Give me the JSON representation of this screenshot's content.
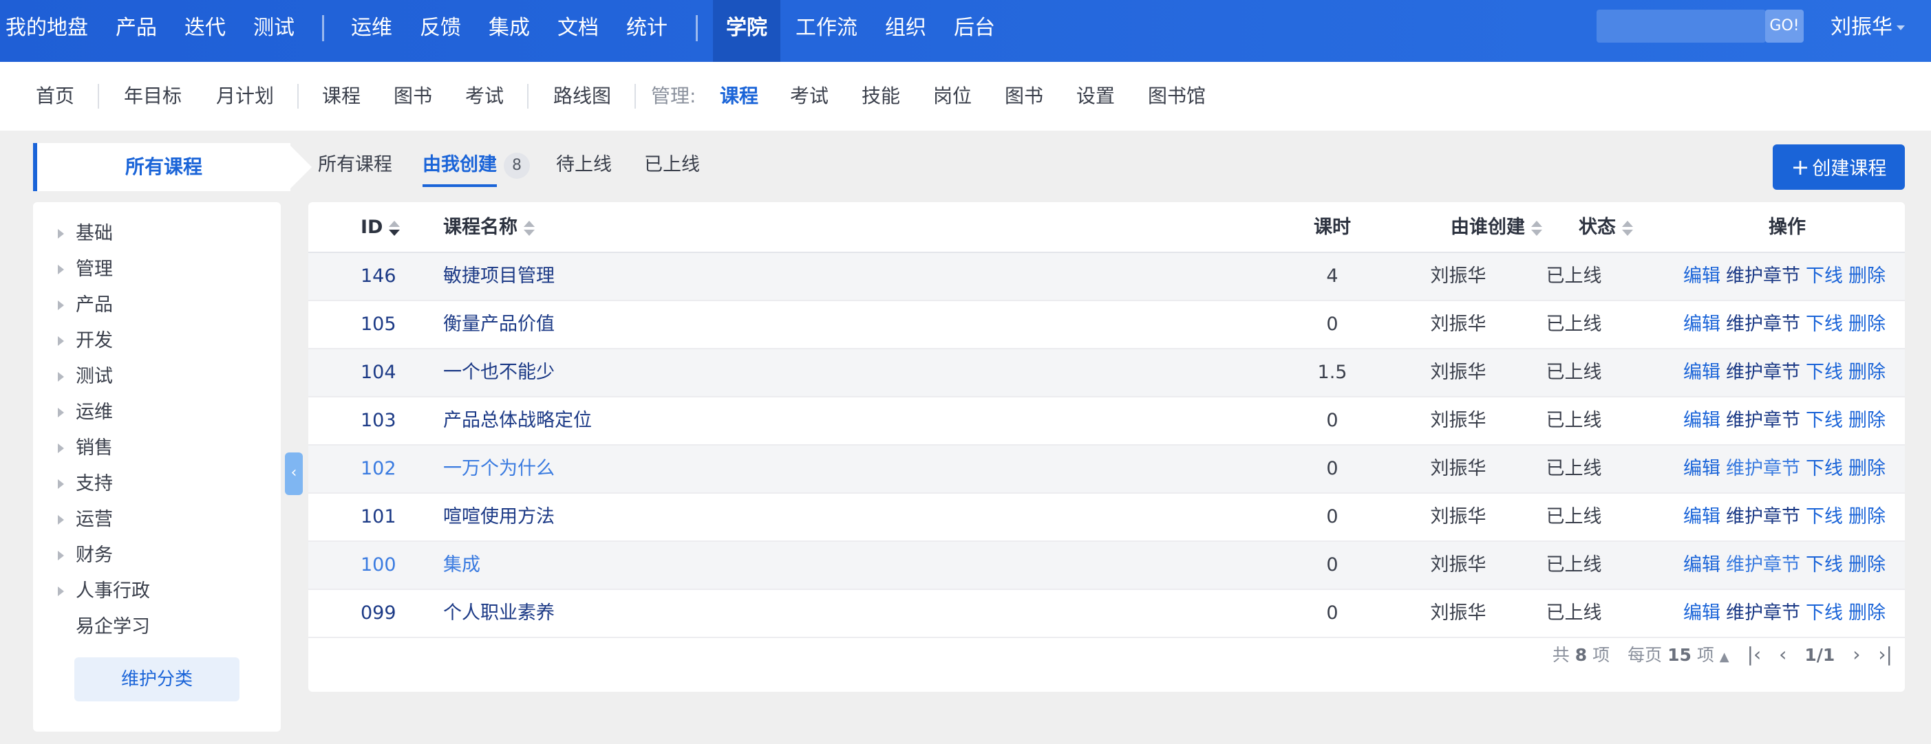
{
  "topnav": {
    "items": [
      "我的地盘",
      "产品",
      "迭代",
      "测试",
      "运维",
      "反馈",
      "集成",
      "文档",
      "统计",
      "学院",
      "工作流",
      "组织",
      "后台"
    ],
    "active": "学院",
    "search_placeholder": "",
    "search_button": "GO!",
    "user": "刘振华"
  },
  "subnav": {
    "items": [
      "首页",
      "年目标",
      "月计划",
      "课程",
      "图书",
      "考试",
      "路线图"
    ],
    "manage_label": "管理:",
    "manage_items": [
      "课程",
      "考试",
      "技能",
      "岗位",
      "图书",
      "设置",
      "图书馆"
    ],
    "active": "课程"
  },
  "sidebar": {
    "title": "所有课程",
    "categories": [
      "基础",
      "管理",
      "产品",
      "开发",
      "测试",
      "运维",
      "销售",
      "支持",
      "运营",
      "财务",
      "人事行政",
      "易企学习"
    ],
    "maintain_button": "维护分类"
  },
  "filters": {
    "tabs": [
      {
        "label": "所有课程"
      },
      {
        "label": "由我创建",
        "count": "8"
      },
      {
        "label": "待上线"
      },
      {
        "label": "已上线"
      }
    ],
    "active": "由我创建"
  },
  "create_button": "创建课程",
  "create_icon": "plus-icon",
  "table": {
    "columns": {
      "id": "ID",
      "name": "课程名称",
      "hours": "课时",
      "creator": "由谁创建",
      "status": "状态",
      "ops": "操作"
    },
    "rows": [
      {
        "id": "146",
        "name": "敏捷项目管理",
        "hours": "4",
        "creator": "刘振华",
        "status": "已上线"
      },
      {
        "id": "105",
        "name": "衡量产品价值",
        "hours": "0",
        "creator": "刘振华",
        "status": "已上线"
      },
      {
        "id": "104",
        "name": "一个也不能少",
        "hours": "1.5",
        "creator": "刘振华",
        "status": "已上线"
      },
      {
        "id": "103",
        "name": "产品总体战略定位",
        "hours": "0",
        "creator": "刘振华",
        "status": "已上线"
      },
      {
        "id": "102",
        "name": "一万个为什么",
        "hours": "0",
        "creator": "刘振华",
        "status": "已上线"
      },
      {
        "id": "101",
        "name": "喧喧使用方法",
        "hours": "0",
        "creator": "刘振华",
        "status": "已上线"
      },
      {
        "id": "100",
        "name": "集成",
        "hours": "0",
        "creator": "刘振华",
        "status": "已上线"
      },
      {
        "id": "099",
        "name": "个人职业素养",
        "hours": "0",
        "creator": "刘振华",
        "status": "已上线"
      }
    ],
    "row_actions": [
      "编辑",
      "维护章节",
      "下线",
      "删除"
    ]
  },
  "pager": {
    "total_prefix": "共",
    "total": "8",
    "total_suffix": "项",
    "per_page_prefix": "每页",
    "per_page": "15",
    "per_page_suffix": "项",
    "page": "1/1"
  },
  "colors": {
    "primary": "#1a64d8",
    "topbar": "#2166dc",
    "active_topnav": "#1a54bf"
  }
}
